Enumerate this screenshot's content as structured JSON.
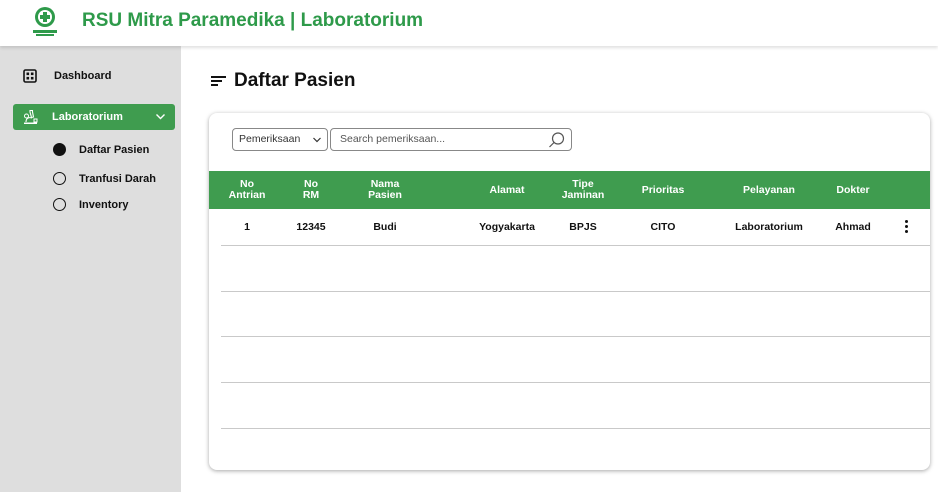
{
  "app": {
    "title": "RSU Mitra Paramedika | Laboratorium"
  },
  "sidebar": {
    "items": [
      {
        "label": "Dashboard",
        "icon": "grid-icon"
      },
      {
        "label": "Laboratorium",
        "icon": "microscope-icon",
        "expanded": true,
        "active": true
      }
    ],
    "sub_items": [
      {
        "label": "Daftar Pasien",
        "selected": true
      },
      {
        "label": "Tranfusi Darah",
        "selected": false
      },
      {
        "label": "Inventory",
        "selected": false
      }
    ]
  },
  "main": {
    "title": "Daftar Pasien",
    "filter": {
      "selected": "Pemeriksaan"
    },
    "search": {
      "placeholder": "Search pemeriksaan..."
    },
    "table": {
      "headers": [
        "No\nAntrian",
        "No\nRM",
        "Nama\nPasien",
        "Alamat",
        "Tipe\nJaminan",
        "Prioritas",
        "Pelayanan",
        "Dokter"
      ],
      "rows": [
        [
          "1",
          "12345",
          "Budi",
          "Yogyakarta",
          "BPJS",
          "CITO",
          "Laboratorium",
          "Ahmad"
        ]
      ]
    }
  },
  "colors": {
    "brand_green": "#3f9c4f",
    "title_green": "#2e9a4a",
    "sidebar_bg": "#dedede"
  }
}
